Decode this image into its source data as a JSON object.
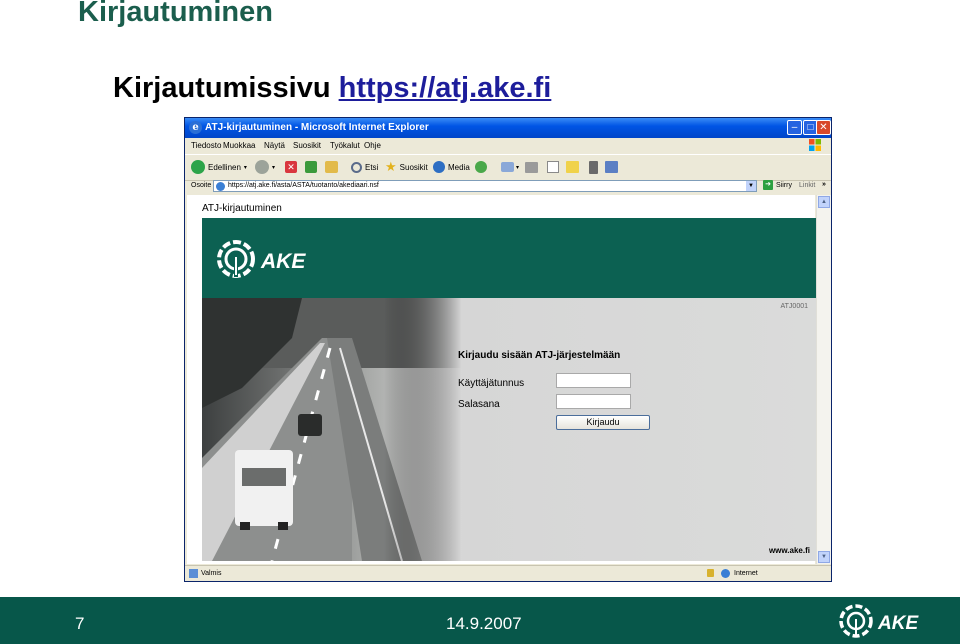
{
  "slide": {
    "title": "Kirjautuminen",
    "subtitle_prefix": "Kirjautumissivu",
    "subtitle_link": "https://atj.ake.fi",
    "page_number": "7",
    "date": "14.9.2007"
  },
  "browser": {
    "window_title": "ATJ-kirjautuminen - Microsoft Internet Explorer",
    "menu": [
      "Tiedosto",
      "Muokkaa",
      "Näytä",
      "Suosikit",
      "Työkalut",
      "Ohje"
    ],
    "toolbar": {
      "back_label": "Edellinen",
      "search_label": "Etsi",
      "favorites_label": "Suosikit",
      "media_label": "Media"
    },
    "address_label": "Osoite",
    "address_url": "https://atj.ake.fi/asta/ASTA/tuotanto/akediaari.nsf",
    "go_label": "Siirry",
    "links_label": "Linkit",
    "status_text": "Valmis",
    "zone_text": "Internet"
  },
  "page": {
    "heading": "ATJ-kirjautuminen",
    "logo_text": "AKE",
    "code": "ATJ0001",
    "login_title": "Kirjaudu sisään ATJ-järjestelmään",
    "username_label": "Käyttäjätunnus",
    "password_label": "Salasana",
    "login_button": "Kirjaudu",
    "site_url": "www.ake.fi"
  },
  "colors": {
    "brand_green": "#0c6152",
    "footer_green": "#07574a",
    "xp_blue": "#0055e5"
  }
}
